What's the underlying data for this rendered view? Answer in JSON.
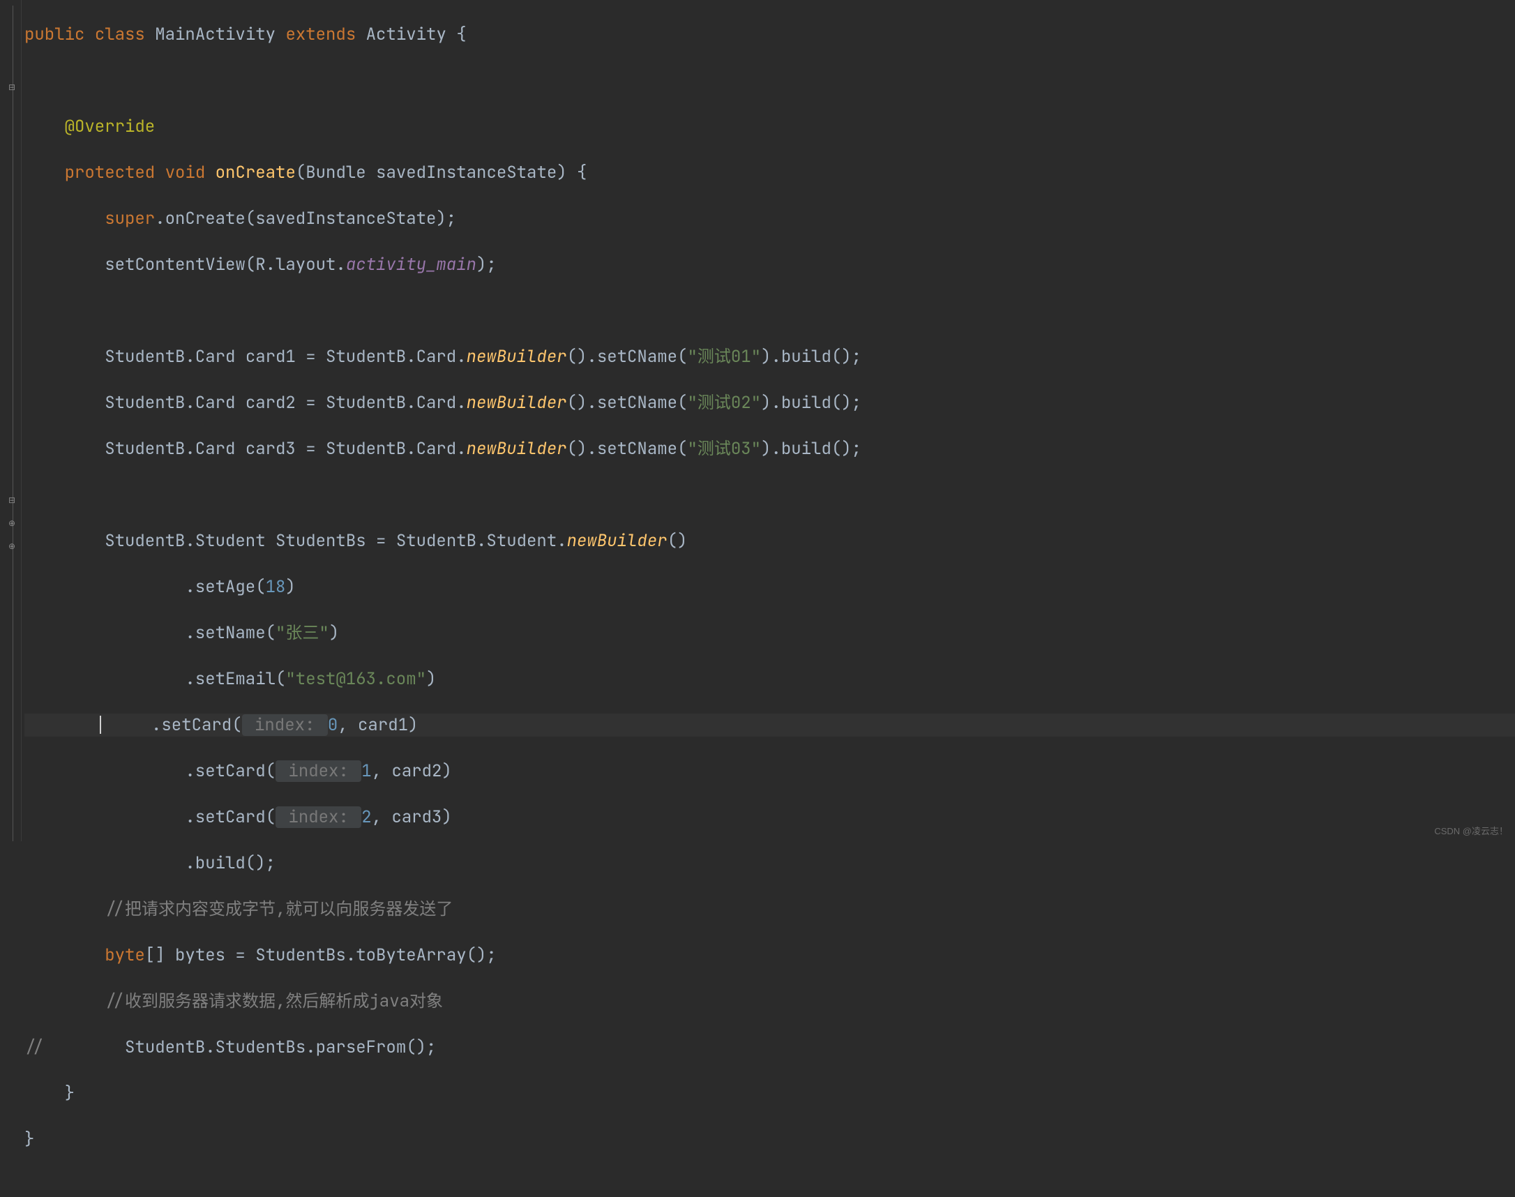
{
  "code": {
    "l1": {
      "kw_public": "public",
      "kw_class": "class",
      "name": "MainActivity",
      "kw_extends": "extends",
      "super": "Activity",
      "brace": "{"
    },
    "l2": "",
    "l3": {
      "ann": "@Override"
    },
    "l4": {
      "kw_protected": "protected",
      "kw_void": "void",
      "name": "onCreate",
      "params": "(Bundle savedInstanceState) {"
    },
    "l5": {
      "kw_super": "super",
      "rest": ".onCreate(savedInstanceState);"
    },
    "l6": {
      "call": "setContentView(R.layout.",
      "field": "activity_main",
      "end": ");"
    },
    "l7": "",
    "l8": {
      "type": "StudentB.Card",
      "var": "card1",
      "assign": " = StudentB.Card.",
      "m": "newBuilder",
      "mid": "().setCName(",
      "str": "\"测试01\"",
      "end": ").build();"
    },
    "l9": {
      "type": "StudentB.Card",
      "var": "card2",
      "assign": " = StudentB.Card.",
      "m": "newBuilder",
      "mid": "().setCName(",
      "str": "\"测试02\"",
      "end": ").build();"
    },
    "l10": {
      "type": "StudentB.Card",
      "var": "card3",
      "assign": " = StudentB.Card.",
      "m": "newBuilder",
      "mid": "().setCName(",
      "str": "\"测试03\"",
      "end": ").build();"
    },
    "l11": "",
    "l12": {
      "type": "StudentB.Student",
      "var": "StudentBs",
      "assign": " = StudentB.Student.",
      "m": "newBuilder",
      "end": "()"
    },
    "l13": {
      "call": ".setAge(",
      "num": "18",
      "end": ")"
    },
    "l14": {
      "call": ".setName(",
      "str": "\"张三\"",
      "end": ")"
    },
    "l15": {
      "call": ".setEmail(",
      "str": "\"test@163.com\"",
      "end": ")"
    },
    "l16": {
      "call": ".setCard(",
      "hint": " index: ",
      "num": "0",
      "mid": ", ",
      "arg": "card1",
      "end": ")"
    },
    "l17": {
      "call": ".setCard(",
      "hint": " index: ",
      "num": "1",
      "mid": ", ",
      "arg": "card2",
      "end": ")"
    },
    "l18": {
      "call": ".setCard(",
      "hint": " index: ",
      "num": "2",
      "mid": ", ",
      "arg": "card3",
      "end": ")"
    },
    "l19": {
      "call": ".build();"
    },
    "l20": {
      "cmt": "//把请求内容变成字节,就可以向服务器发送了"
    },
    "l21": {
      "kw": "byte",
      "arr": "[]",
      "var": "bytes",
      "rest": " = StudentBs.toByteArray();"
    },
    "l22": {
      "cmt": "//收到服务器请求数据,然后解析成java对象"
    },
    "l23": {
      "cmtmark": "//",
      "rest": "    StudentB.StudentBs.parseFrom();"
    },
    "l24": {
      "brace": "}"
    },
    "l25": {
      "brace": "}"
    }
  },
  "watermark": "CSDN @凌云志！"
}
